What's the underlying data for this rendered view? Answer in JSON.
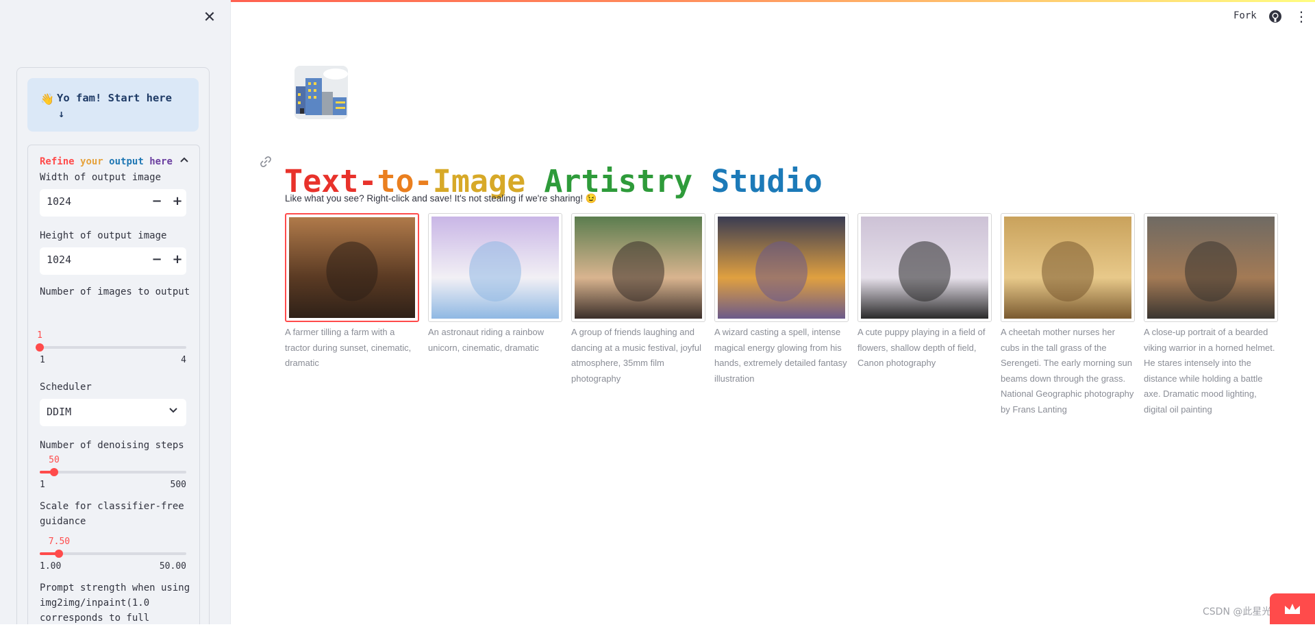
{
  "header": {
    "fork_label": "Fork",
    "github_icon": "github-icon",
    "menu_icon": "kebab-menu-icon"
  },
  "sidebar": {
    "close_icon": "close-icon",
    "info_box": {
      "icon": "waving-hand-emoji",
      "text": "Yo fam! Start here",
      "arrow": "↓"
    },
    "expander": {
      "title_words": [
        "Refine",
        "your",
        "output",
        "here"
      ],
      "expanded": true,
      "fields": {
        "width_label": "Width of output image",
        "width_value": "1024",
        "height_label": "Height of output image",
        "height_value": "1024",
        "num_images_label": "Number of images to output",
        "num_images": {
          "current": "1",
          "min": "1",
          "max": "4",
          "fraction": 0.0
        },
        "scheduler_label": "Scheduler",
        "scheduler_value": "DDIM",
        "steps_label": "Number of denoising steps",
        "steps": {
          "current": "50",
          "min": "1",
          "max": "500",
          "fraction": 0.098
        },
        "guidance_label": "Scale for classifier-free guidance",
        "guidance": {
          "current": "7.50",
          "min": "1.00",
          "max": "50.00",
          "fraction": 0.133
        },
        "prompt_strength_label": "Prompt strength when using img2img/inpaint(1.0 corresponds to full"
      },
      "stepper_minus": "−",
      "stepper_plus": "+"
    }
  },
  "main": {
    "logo_icon": "city-buildings-icon",
    "title": "Text-to-Image Artistry Studio",
    "title_colors": [
      "#e8322b",
      "#ea7f1f",
      "#d7a928",
      "#2e9b3a",
      "#1c7ab8",
      "#6a3fb0"
    ],
    "subtitle": "Like what you see? Right-click and save! It's not stealing if we're sharing! 😉",
    "gallery": [
      {
        "caption": "A farmer tilling a farm with a tractor during sunset, cinematic, dramatic",
        "selected": true
      },
      {
        "caption": "An astronaut riding a rainbow unicorn, cinematic, dramatic",
        "selected": false
      },
      {
        "caption": "A group of friends laughing and dancing at a music festival, joyful atmosphere, 35mm film photography",
        "selected": false
      },
      {
        "caption": "A wizard casting a spell, intense magical energy glowing from his hands, extremely detailed fantasy illustration",
        "selected": false
      },
      {
        "caption": "A cute puppy playing in a field of flowers, shallow depth of field, Canon photography",
        "selected": false
      },
      {
        "caption": "A cheetah mother nurses her cubs in the tall grass of the Serengeti. The early morning sun beams down through the grass. National Geographic photography by Frans Lanting",
        "selected": false
      },
      {
        "caption": "A close-up portrait of a bearded viking warrior in a horned helmet. He stares intensely into the distance while holding a battle axe. Dramatic mood lighting, digital oil painting",
        "selected": false
      }
    ]
  },
  "footer": {
    "watermark": "CSDN @此星光明",
    "badge_icon": "crown-icon"
  }
}
